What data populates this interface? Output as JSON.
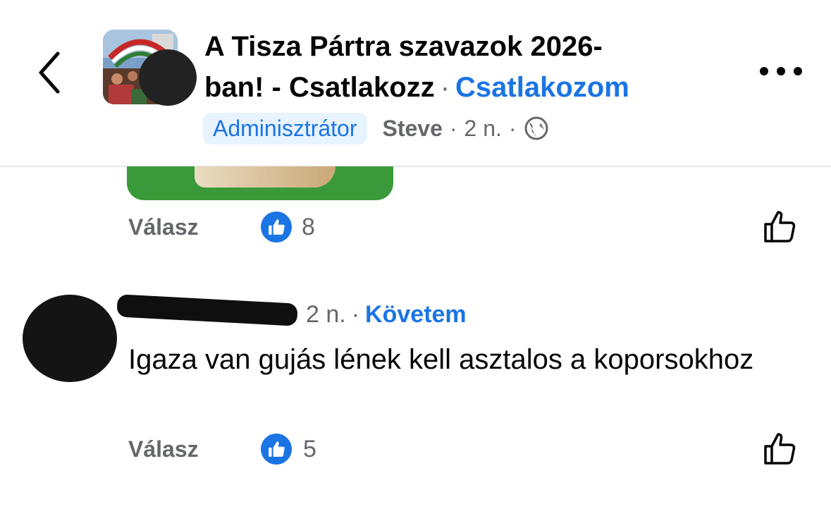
{
  "header": {
    "title_line1": "A Tisza Pártra szavazok 2026-",
    "title_line2": "ban! - Csatlakozz",
    "separator": "·",
    "join_label": "Csatlakozom",
    "admin_badge": "Adminisztrátor",
    "author": "Steve",
    "meta_sep1": "·",
    "time": "2 n.",
    "meta_sep2": "·"
  },
  "first_comment": {
    "reply_label": "Válasz",
    "like_count": "8"
  },
  "second_comment": {
    "time": "2 n.",
    "separator": "·",
    "follow_label": "Követem",
    "text": "Igaza van gujás lének kell asztalos a koporsokhoz",
    "reply_label": "Válasz",
    "like_count": "5"
  },
  "icons": {
    "back": "chevron-left-icon",
    "more": "more-icon",
    "audience": "globe-icon",
    "reaction": "thumbs-up-icon"
  },
  "colors": {
    "accent": "#1b74e4",
    "muted": "#65676b",
    "badge_bg": "#e7f3ff"
  }
}
